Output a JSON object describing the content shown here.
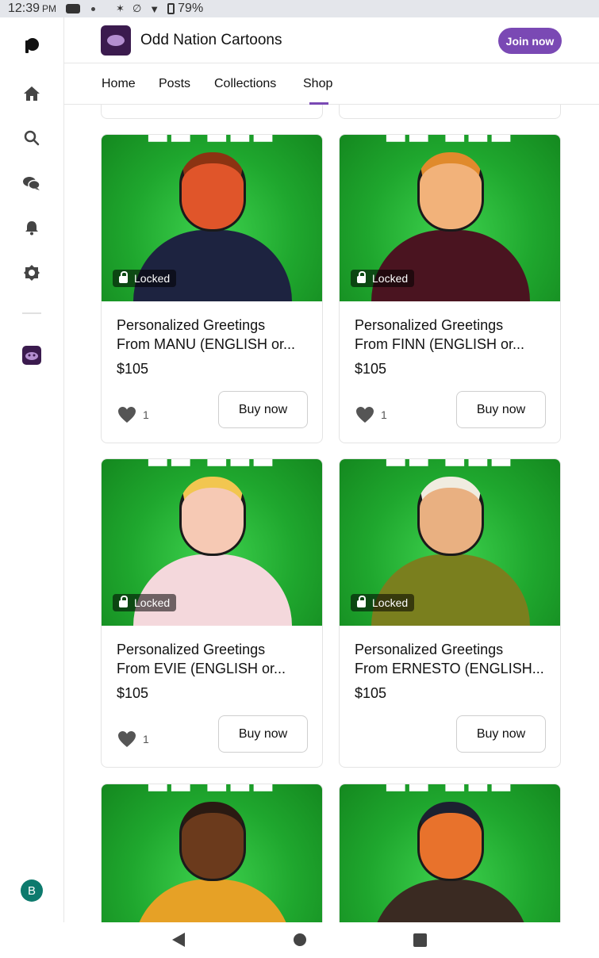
{
  "status_bar": {
    "time": "12:39",
    "ampm": "PM",
    "battery": "79%"
  },
  "header": {
    "title": "Odd Nation Cartoons",
    "join_label": "Join now"
  },
  "tabs": [
    "Home",
    "Posts",
    "Collections",
    "Shop"
  ],
  "active_tab": "Shop",
  "user_initial": "B",
  "locked_label": "Locked",
  "buy_label": "Buy now",
  "products": [
    {
      "name_line1": "Personalized Greetings",
      "name_line2": "From MANU (ENGLISH or...",
      "price": "$105",
      "likes": "1",
      "skin": "#e0552a",
      "outfit": "#1d2340",
      "hair": "#8b3312"
    },
    {
      "name_line1": "Personalized Greetings",
      "name_line2": "From FINN (ENGLISH or...",
      "price": "$105",
      "likes": "1",
      "skin": "#f2b27a",
      "outfit": "#4a1420",
      "hair": "#e08a2c"
    },
    {
      "name_line1": "Personalized Greetings",
      "name_line2": "From EVIE (ENGLISH or...",
      "price": "$105",
      "likes": "1",
      "skin": "#f6c9b4",
      "outfit": "#f4d8dc",
      "hair": "#f2c650"
    },
    {
      "name_line1": "Personalized Greetings",
      "name_line2": "From ERNESTO (ENGLISH...",
      "price": "$105",
      "likes": "",
      "skin": "#e9b081",
      "outfit": "#7a7f1e",
      "hair": "#f0ece0"
    },
    {
      "skin": "#6b3a1c",
      "outfit": "#e6a126",
      "hair": "#2a1a12"
    },
    {
      "skin": "#e8722c",
      "outfit": "#3a2a22",
      "hair": "#1c2130"
    }
  ],
  "colors": {
    "accent": "#7a49b4",
    "image_bg": "#1fa72e",
    "user_avatar": "#0d7a6d"
  },
  "icons": [
    "patreon-logo-icon",
    "home-icon",
    "search-icon",
    "chat-icon",
    "bell-icon",
    "settings-icon",
    "heart-icon",
    "lock-icon",
    "back-icon",
    "home-circle-icon",
    "recents-icon"
  ]
}
